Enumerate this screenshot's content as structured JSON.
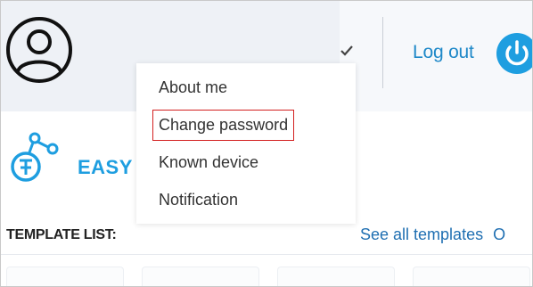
{
  "header": {
    "avatar_icon": "user-circle-icon",
    "chevron_icon": "checkmark-chevron-icon",
    "logout_label": "Log out",
    "power_icon": "power-icon",
    "accent_color": "#1e9ee0"
  },
  "dropdown": {
    "items": [
      {
        "label": "About me"
      },
      {
        "label": "Change password",
        "highlighted": true
      },
      {
        "label": "Known device"
      },
      {
        "label": "Notification"
      }
    ],
    "highlight_color": "#d32020"
  },
  "main": {
    "brand_icon": "token-network-icon",
    "brand_text": "EASY",
    "template_list_label": "TEMPLATE LIST:",
    "see_all_label": "See all templates",
    "overflow_char": "O"
  }
}
